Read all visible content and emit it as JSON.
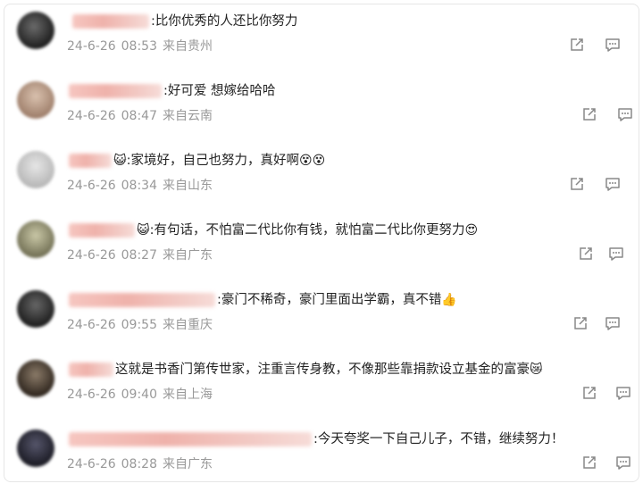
{
  "comments": [
    {
      "text": ":比你优秀的人还比你努力",
      "emoji": "",
      "date": "24-6-26",
      "time": "08:53",
      "location": "来自贵州",
      "avatar_color": "#2b2b2b"
    },
    {
      "text": ":好可爱 想嫁给哈哈",
      "emoji": "",
      "date": "24-6-26",
      "time": "08:47",
      "location": "来自云南",
      "avatar_color": "#b89a84"
    },
    {
      "text": ":家境好，自己也努力，真好啊",
      "emoji": "😵😵",
      "prefix_emoji": "😺",
      "date": "24-6-26",
      "time": "08:34",
      "location": "来自山东",
      "avatar_color": "#c8c8c8"
    },
    {
      "text": ":有句话，不怕富二代比你有钱，就怕富二代比你更努力",
      "emoji": "😍",
      "prefix_emoji": "😺",
      "date": "24-6-26",
      "time": "08:27",
      "location": "来自广东",
      "avatar_color": "#8c8a6a"
    },
    {
      "text": ":豪门不稀奇，豪门里面出学霸，真不错",
      "emoji": "👍",
      "date": "24-6-26",
      "time": "09:55",
      "location": "来自重庆",
      "avatar_color": "#2d2d2d"
    },
    {
      "text": "这就是书香门第传世家，注重言传身教，不像那些靠捐款设立基金的富豪",
      "emoji": "😿",
      "date": "24-6-26",
      "time": "09:40",
      "location": "来自上海",
      "avatar_color": "#4a3e33"
    },
    {
      "text": ":今天夸奖一下自己儿子，不错，继续努力！",
      "emoji": "",
      "date": "24-6-26",
      "time": "08:28",
      "location": "来自广东",
      "avatar_color": "#2f2f3a"
    }
  ],
  "icons": {
    "share": "share-icon",
    "reply": "comment-icon"
  },
  "colors": {
    "meta": "#999999",
    "text": "#222222",
    "icon": "#888888"
  }
}
